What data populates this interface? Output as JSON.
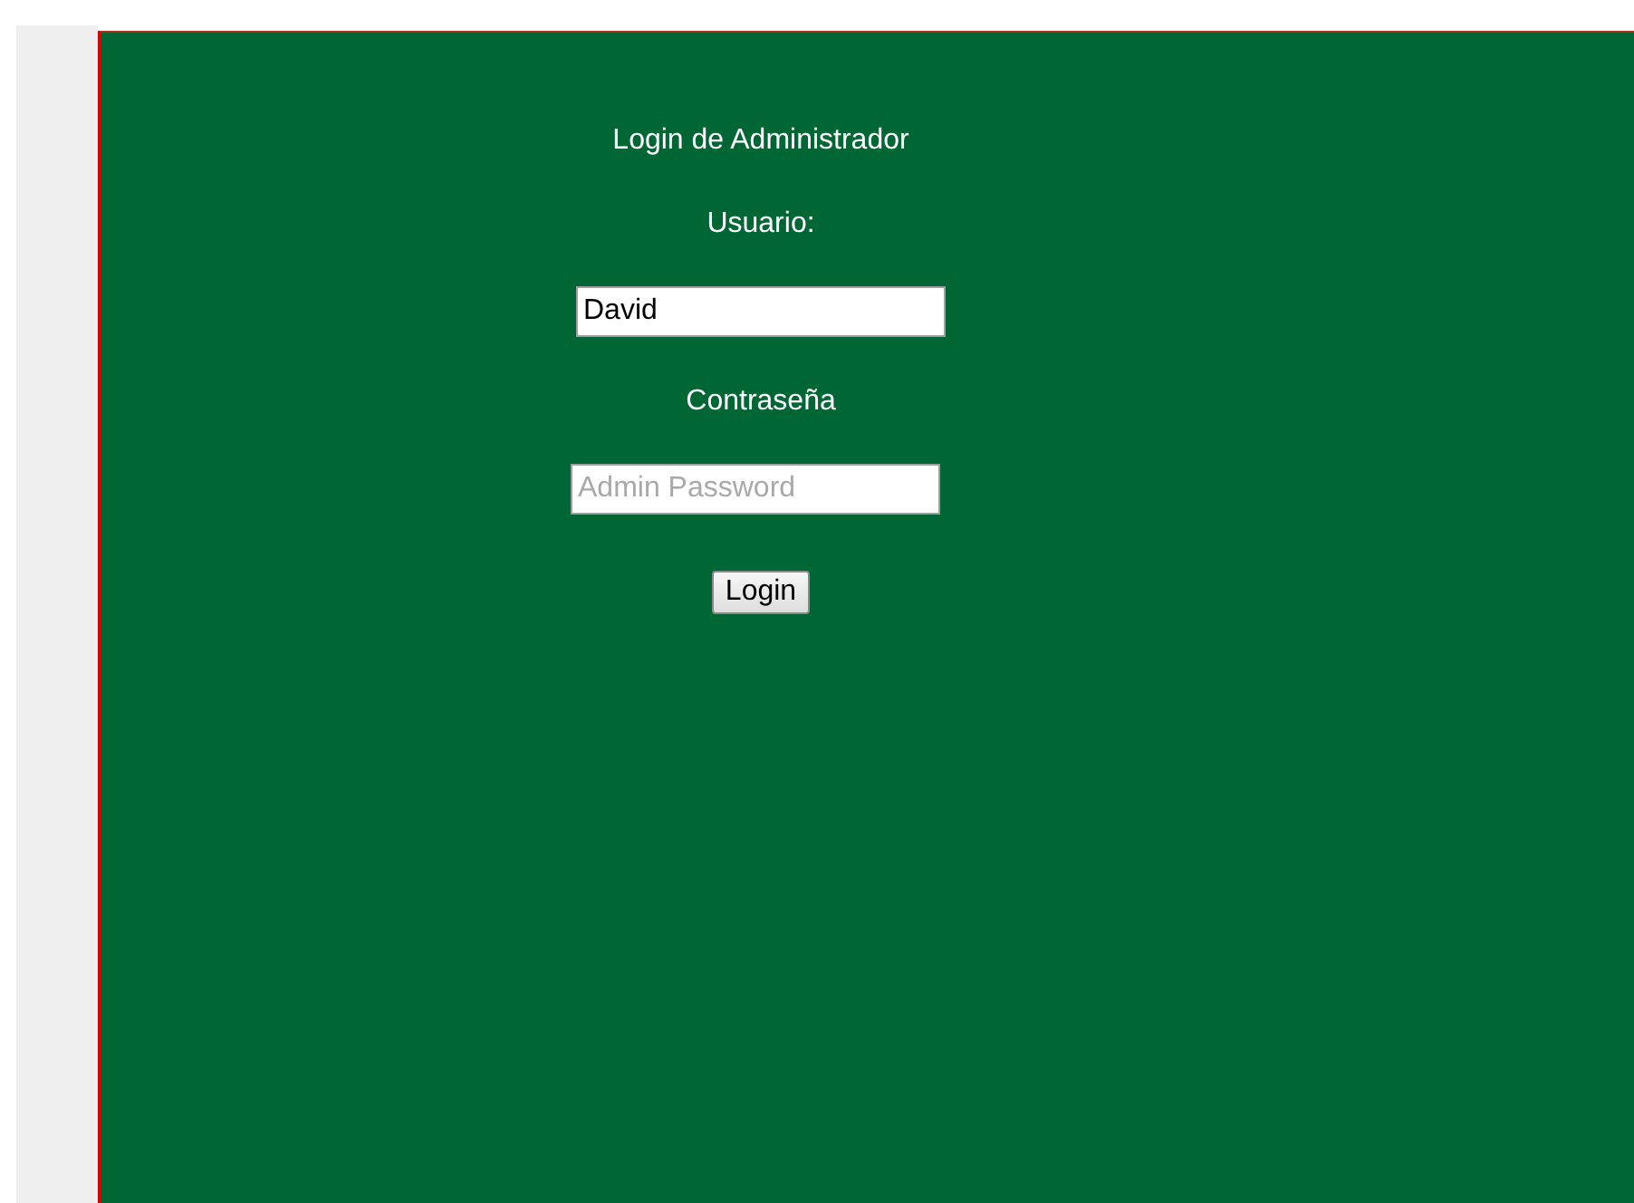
{
  "login_form": {
    "title": "Login de Administrador",
    "username_label": "Usuario:",
    "username_value": "David",
    "password_label": "Contraseña",
    "password_placeholder": "Admin Password",
    "submit_button": "Login"
  }
}
